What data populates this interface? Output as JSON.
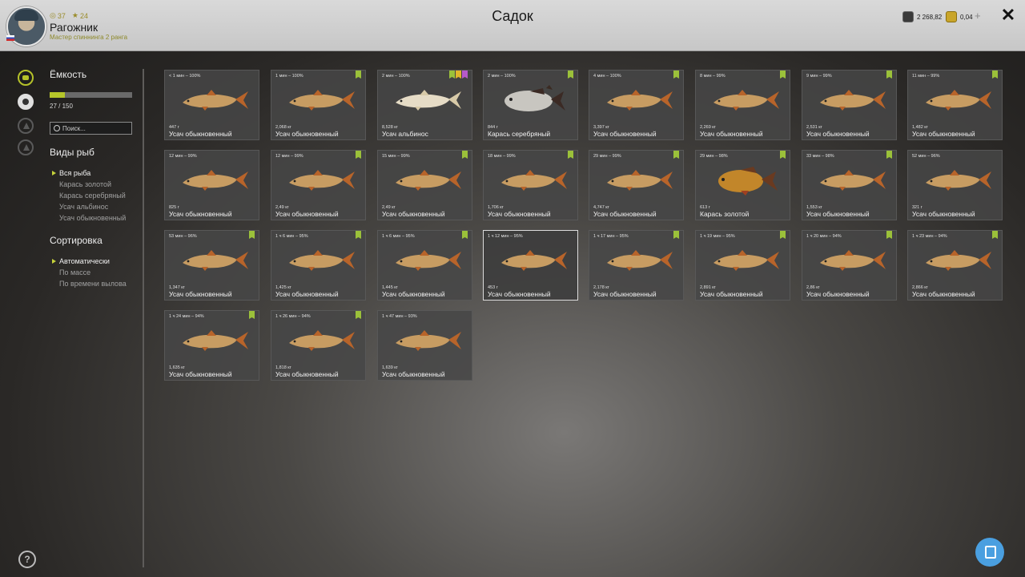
{
  "header": {
    "title": "Садок",
    "level": "37",
    "stars": "24",
    "player_name": "Рагожник",
    "player_rank": "Мастер спиннинга 2 ранга",
    "silver": "2 268,82",
    "gold": "0,04"
  },
  "capacity": {
    "label": "Ёмкость",
    "text": "27 / 150",
    "fill_fraction": 0.18
  },
  "search": {
    "placeholder": "Поиск..."
  },
  "species_filter": {
    "title": "Виды рыб",
    "options": [
      "Вся рыба",
      "Карась золотой",
      "Карась серебряный",
      "Усач альбинос",
      "Усач обыкновенный"
    ],
    "selected_index": 0
  },
  "sorting": {
    "title": "Сортировка",
    "options": [
      "Автоматически",
      "По массе",
      "По времени вылова"
    ],
    "selected_index": 0
  },
  "colors": {
    "accent": "#b6c62a",
    "badge_green": "#9bc13a",
    "badge_yellow": "#e0b52a",
    "badge_purple": "#b659c9"
  },
  "fish": [
    {
      "time": "< 1 мин – 100%",
      "weight": "447 г",
      "name": "Усач обыкновенный",
      "kind": "barbel",
      "badges": []
    },
    {
      "time": "1 мин – 100%",
      "weight": "2,068 кг",
      "name": "Усач обыкновенный",
      "kind": "barbel",
      "badges": [
        "g"
      ]
    },
    {
      "time": "2 мин – 100%",
      "weight": "8,528 кг",
      "name": "Усач альбинос",
      "kind": "albino",
      "badges": [
        "g",
        "y",
        "p"
      ]
    },
    {
      "time": "2 мин – 100%",
      "weight": "844 г",
      "name": "Карась серебряный",
      "kind": "silver",
      "badges": [
        "g"
      ]
    },
    {
      "time": "4 мин – 100%",
      "weight": "3,397 кг",
      "name": "Усач обыкновенный",
      "kind": "barbel",
      "badges": [
        "g"
      ]
    },
    {
      "time": "8 мин – 99%",
      "weight": "2,269 кг",
      "name": "Усач обыкновенный",
      "kind": "barbel",
      "badges": [
        "g"
      ]
    },
    {
      "time": "9 мин – 99%",
      "weight": "2,531 кг",
      "name": "Усач обыкновенный",
      "kind": "barbel",
      "badges": [
        "g"
      ]
    },
    {
      "time": "11 мин – 99%",
      "weight": "1,482 кг",
      "name": "Усач обыкновенный",
      "kind": "barbel",
      "badges": [
        "g"
      ]
    },
    {
      "time": "12 мин – 99%",
      "weight": "825 г",
      "name": "Усач обыкновенный",
      "kind": "barbel",
      "badges": []
    },
    {
      "time": "12 мин – 99%",
      "weight": "2,49 кг",
      "name": "Усач обыкновенный",
      "kind": "barbel",
      "badges": [
        "g"
      ]
    },
    {
      "time": "15 мин – 99%",
      "weight": "2,49 кг",
      "name": "Усач обыкновенный",
      "kind": "barbel",
      "badges": [
        "g"
      ]
    },
    {
      "time": "18 мин – 99%",
      "weight": "1,706 кг",
      "name": "Усач обыкновенный",
      "kind": "barbel",
      "badges": [
        "g"
      ]
    },
    {
      "time": "29 мин – 99%",
      "weight": "4,747 кг",
      "name": "Усач обыкновенный",
      "kind": "barbel",
      "badges": [
        "g"
      ]
    },
    {
      "time": "29 мин – 98%",
      "weight": "613 г",
      "name": "Карась золотой",
      "kind": "golden",
      "badges": [
        "g"
      ]
    },
    {
      "time": "33 мин – 98%",
      "weight": "1,553 кг",
      "name": "Усач обыкновенный",
      "kind": "barbel",
      "badges": [
        "g"
      ]
    },
    {
      "time": "52 мин – 96%",
      "weight": "321 г",
      "name": "Усач обыкновенный",
      "kind": "barbel",
      "badges": []
    },
    {
      "time": "53 мин – 96%",
      "weight": "1,347 кг",
      "name": "Усач обыкновенный",
      "kind": "barbel",
      "badges": [
        "g"
      ]
    },
    {
      "time": "1 ч 6 мин – 95%",
      "weight": "1,425 кг",
      "name": "Усач обыкновенный",
      "kind": "barbel",
      "badges": [
        "g"
      ]
    },
    {
      "time": "1 ч 6 мин – 95%",
      "weight": "1,445 кг",
      "name": "Усач обыкновенный",
      "kind": "barbel",
      "badges": [
        "g"
      ]
    },
    {
      "time": "1 ч 12 мин – 95%",
      "weight": "453 г",
      "name": "Усач обыкновенный",
      "kind": "barbel",
      "badges": [],
      "selected": true
    },
    {
      "time": "1 ч 17 мин – 95%",
      "weight": "2,178 кг",
      "name": "Усач обыкновенный",
      "kind": "barbel",
      "badges": [
        "g"
      ]
    },
    {
      "time": "1 ч 19 мин – 95%",
      "weight": "2,891 кг",
      "name": "Усач обыкновенный",
      "kind": "barbel",
      "badges": [
        "g"
      ]
    },
    {
      "time": "1 ч 20 мин – 94%",
      "weight": "2,86 кг",
      "name": "Усач обыкновенный",
      "kind": "barbel",
      "badges": [
        "g"
      ]
    },
    {
      "time": "1 ч 23 мин – 94%",
      "weight": "2,866 кг",
      "name": "Усач обыкновенный",
      "kind": "barbel",
      "badges": [
        "g"
      ]
    },
    {
      "time": "1 ч 24 мин – 94%",
      "weight": "1,635 кг",
      "name": "Усач обыкновенный",
      "kind": "barbel",
      "badges": [
        "g"
      ]
    },
    {
      "time": "1 ч 26 мин – 94%",
      "weight": "1,818 кг",
      "name": "Усач обыкновенный",
      "kind": "barbel",
      "badges": [
        "g"
      ]
    },
    {
      "time": "1 ч 47 мин – 93%",
      "weight": "1,639 кг",
      "name": "Усач обыкновенный",
      "kind": "barbel",
      "badges": []
    }
  ]
}
